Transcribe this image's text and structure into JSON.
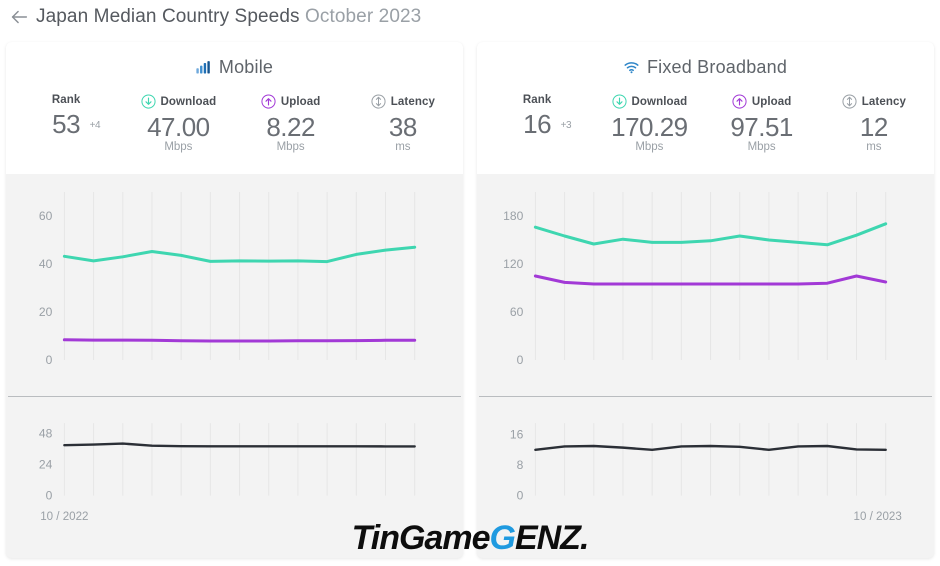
{
  "header": {
    "back_icon": "back-arrow-icon",
    "title_main": "Japan Median Country Speeds",
    "title_date": "October 2023"
  },
  "watermark": {
    "part1": "TinGame",
    "part2": "G",
    "part3": "ENZ.",
    "blue": "#1f9ae0"
  },
  "colors": {
    "download": "#3ed6b0",
    "upload": "#a239d6",
    "latency": "#2b2f36",
    "panel_bg": "#f3f3f3",
    "card_bg": "#ffffff",
    "text": "#6a6e74",
    "muted": "#9aa0a6"
  },
  "panels": [
    {
      "id": "mobile",
      "icon": "signal-bars-icon",
      "title": "Mobile",
      "metrics": [
        {
          "name": "rank",
          "icon": null,
          "label": "Rank",
          "value": "53",
          "unit": "",
          "delta": "+4"
        },
        {
          "name": "download",
          "icon": "download-icon",
          "label": "Download",
          "value": "47.00",
          "unit": "Mbps",
          "delta": null
        },
        {
          "name": "upload",
          "icon": "upload-icon",
          "label": "Upload",
          "value": "8.22",
          "unit": "Mbps",
          "delta": null
        },
        {
          "name": "latency",
          "icon": "latency-icon",
          "label": "Latency",
          "value": "38",
          "unit": "ms",
          "delta": null
        }
      ],
      "x_start_label": "10 / 2022",
      "x_end_label": "",
      "chart_data": [
        {
          "type": "line",
          "name": "mobile-speeds",
          "title": "Mobile Download / Upload",
          "ylabel": "Mbps",
          "xlabel": "",
          "ylim": [
            0,
            70
          ],
          "yticks": [
            0,
            20,
            40,
            60
          ],
          "grid": true,
          "legend": "none",
          "x": [
            "10/2022",
            "11/2022",
            "12/2022",
            "01/2023",
            "02/2023",
            "03/2023",
            "04/2023",
            "05/2023",
            "06/2023",
            "07/2023",
            "08/2023",
            "09/2023",
            "10/2023"
          ],
          "series": [
            {
              "name": "Download",
              "color": "#3ed6b0",
              "values": [
                43.2,
                41.3,
                43.0,
                45.2,
                43.6,
                41.1,
                41.3,
                41.2,
                41.3,
                41.0,
                44.0,
                45.8,
                47.0
              ]
            },
            {
              "name": "Upload",
              "color": "#a239d6",
              "values": [
                8.4,
                8.3,
                8.3,
                8.2,
                8.0,
                7.9,
                7.9,
                7.9,
                8.0,
                8.0,
                8.1,
                8.2,
                8.22
              ]
            }
          ]
        },
        {
          "type": "line",
          "name": "mobile-latency",
          "title": "Mobile Latency",
          "ylabel": "ms",
          "xlabel": "",
          "ylim": [
            0,
            56
          ],
          "yticks": [
            0,
            24,
            48
          ],
          "grid": true,
          "legend": "none",
          "x": [
            "10/2022",
            "11/2022",
            "12/2022",
            "01/2023",
            "02/2023",
            "03/2023",
            "04/2023",
            "05/2023",
            "06/2023",
            "07/2023",
            "08/2023",
            "09/2023",
            "10/2023"
          ],
          "series": [
            {
              "name": "Latency",
              "color": "#2b2f36",
              "values": [
                39.0,
                39.4,
                40.2,
                38.6,
                38.2,
                38.1,
                38.1,
                38.1,
                38.1,
                38.1,
                38.1,
                38.0,
                38.0
              ]
            }
          ]
        }
      ]
    },
    {
      "id": "fixed-broadband",
      "icon": "wifi-icon",
      "title": "Fixed Broadband",
      "metrics": [
        {
          "name": "rank",
          "icon": null,
          "label": "Rank",
          "value": "16",
          "unit": "",
          "delta": "+3"
        },
        {
          "name": "download",
          "icon": "download-icon",
          "label": "Download",
          "value": "170.29",
          "unit": "Mbps",
          "delta": null
        },
        {
          "name": "upload",
          "icon": "upload-icon",
          "label": "Upload",
          "value": "97.51",
          "unit": "Mbps",
          "delta": null
        },
        {
          "name": "latency",
          "icon": "latency-icon",
          "label": "Latency",
          "value": "12",
          "unit": "ms",
          "delta": null
        }
      ],
      "x_start_label": "",
      "x_end_label": "10 / 2023",
      "chart_data": [
        {
          "type": "line",
          "name": "fixed-speeds",
          "title": "Fixed Broadband Download / Upload",
          "ylabel": "Mbps",
          "xlabel": "",
          "ylim": [
            0,
            210
          ],
          "yticks": [
            0,
            60,
            120,
            180
          ],
          "grid": true,
          "legend": "none",
          "x": [
            "10/2022",
            "11/2022",
            "12/2022",
            "01/2023",
            "02/2023",
            "03/2023",
            "04/2023",
            "05/2023",
            "06/2023",
            "07/2023",
            "08/2023",
            "09/2023",
            "10/2023"
          ],
          "series": [
            {
              "name": "Download",
              "color": "#3ed6b0",
              "values": [
                166,
                155,
                145,
                151,
                147,
                147,
                149,
                155,
                150,
                147,
                144,
                156,
                170.29
              ]
            },
            {
              "name": "Upload",
              "color": "#a239d6",
              "values": [
                105,
                97,
                95,
                95,
                95,
                95,
                95,
                95,
                95,
                95,
                96,
                105,
                97.51
              ]
            }
          ]
        },
        {
          "type": "line",
          "name": "fixed-latency",
          "title": "Fixed Broadband Latency",
          "ylabel": "ms",
          "xlabel": "",
          "ylim": [
            0,
            19
          ],
          "yticks": [
            0,
            8,
            16
          ],
          "grid": true,
          "legend": "none",
          "x": [
            "10/2022",
            "11/2022",
            "12/2022",
            "01/2023",
            "02/2023",
            "03/2023",
            "04/2023",
            "05/2023",
            "06/2023",
            "07/2023",
            "08/2023",
            "09/2023",
            "10/2023"
          ],
          "series": [
            {
              "name": "Latency",
              "color": "#2b2f36",
              "values": [
                12.0,
                12.9,
                13.0,
                12.6,
                12.0,
                12.9,
                13.0,
                12.8,
                12.0,
                12.9,
                13.0,
                12.1,
                12.0
              ]
            }
          ]
        }
      ]
    }
  ]
}
